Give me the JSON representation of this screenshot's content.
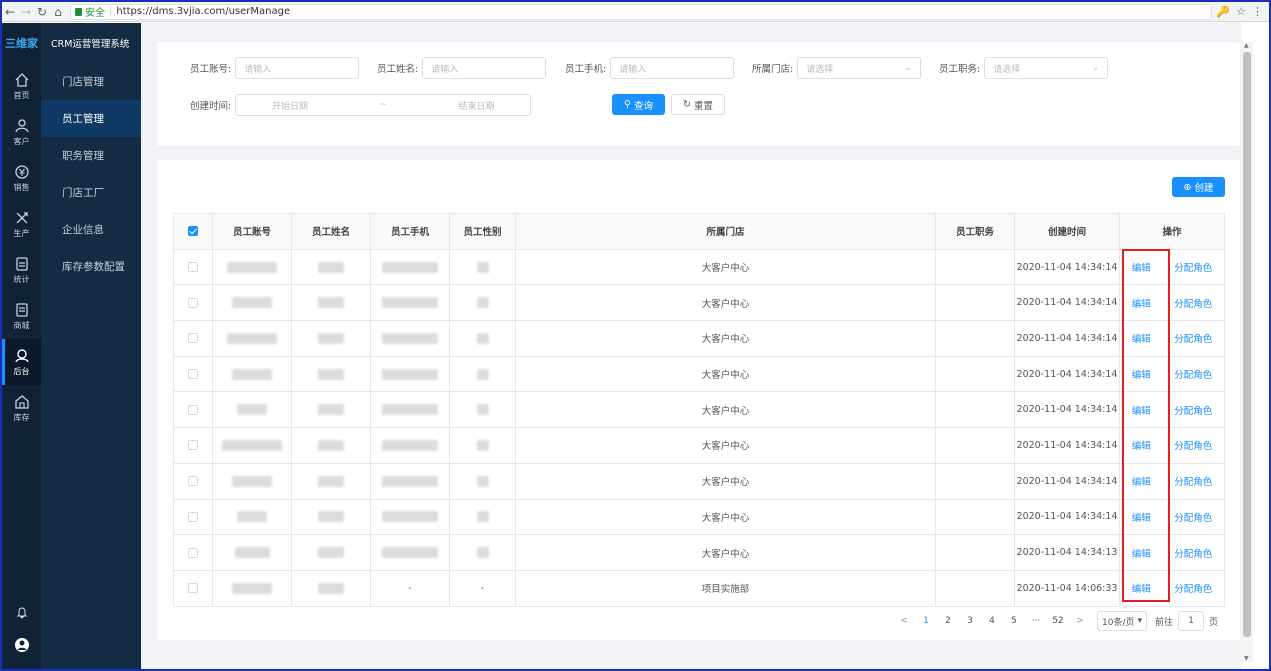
{
  "browser": {
    "secure_label": "安全",
    "url": "https://dms.3vjia.com/userManage"
  },
  "app": {
    "logo_text": "三维家",
    "system_title": "CRM运营管理系统"
  },
  "iconbar": [
    {
      "label": "首页",
      "icon": "home-icon"
    },
    {
      "label": "客户",
      "icon": "customer-icon"
    },
    {
      "label": "销售",
      "icon": "sales-icon"
    },
    {
      "label": "生产",
      "icon": "production-icon"
    },
    {
      "label": "统计",
      "icon": "statistics-icon"
    },
    {
      "label": "商城",
      "icon": "mall-icon"
    },
    {
      "label": "后台",
      "icon": "backend-icon",
      "active": true
    },
    {
      "label": "库存",
      "icon": "inventory-icon"
    }
  ],
  "submenu": [
    {
      "label": "门店管理"
    },
    {
      "label": "员工管理",
      "active": true
    },
    {
      "label": "职务管理"
    },
    {
      "label": "门店工厂"
    },
    {
      "label": "企业信息"
    },
    {
      "label": "库存参数配置"
    }
  ],
  "filters": {
    "account_label": "员工账号:",
    "account_placeholder": "请输入",
    "name_label": "员工姓名:",
    "name_placeholder": "请输入",
    "phone_label": "员工手机:",
    "phone_placeholder": "请输入",
    "store_label": "所属门店:",
    "store_placeholder": "请选择",
    "position_label": "员工职务:",
    "position_placeholder": "请选择",
    "created_label": "创建时间:",
    "start_placeholder": "开始日期",
    "range_sep": "~",
    "end_placeholder": "结束日期",
    "query_button": "查询",
    "reset_button": "重置"
  },
  "create_button": "创建",
  "table": {
    "headers": [
      "员工账号",
      "员工姓名",
      "员工手机",
      "员工性别",
      "所属门店",
      "员工职务",
      "创建时间",
      "操作"
    ],
    "edit_label": "编辑",
    "assign_label": "分配角色",
    "rows": [
      {
        "store": "大客户中心",
        "position": "",
        "created": "2020-11-04 14:34:14",
        "phone": "",
        "gender": ""
      },
      {
        "store": "大客户中心",
        "position": "",
        "created": "2020-11-04 14:34:14",
        "phone": "",
        "gender": ""
      },
      {
        "store": "大客户中心",
        "position": "",
        "created": "2020-11-04 14:34:14",
        "phone": "",
        "gender": ""
      },
      {
        "store": "大客户中心",
        "position": "",
        "created": "2020-11-04 14:34:14",
        "phone": "",
        "gender": ""
      },
      {
        "store": "大客户中心",
        "position": "",
        "created": "2020-11-04 14:34:14",
        "phone": "",
        "gender": ""
      },
      {
        "store": "大客户中心",
        "position": "",
        "created": "2020-11-04 14:34:14",
        "phone": "",
        "gender": ""
      },
      {
        "store": "大客户中心",
        "position": "",
        "created": "2020-11-04 14:34:14",
        "phone": "",
        "gender": ""
      },
      {
        "store": "大客户中心",
        "position": "",
        "created": "2020-11-04 14:34:14",
        "phone": "",
        "gender": ""
      },
      {
        "store": "大客户中心",
        "position": "",
        "created": "2020-11-04 14:34:13",
        "phone": "",
        "gender": ""
      },
      {
        "store": "项目实施部",
        "position": "",
        "created": "2020-11-04 14:06:33",
        "phone": "-",
        "gender": "-"
      }
    ]
  },
  "pagination": {
    "prev": "<",
    "pages": [
      "1",
      "2",
      "3",
      "4",
      "5",
      "···",
      "52"
    ],
    "next": ">",
    "page_size": "10条/页",
    "goto_label": "前往",
    "goto_value": "1",
    "page_unit": "页"
  }
}
